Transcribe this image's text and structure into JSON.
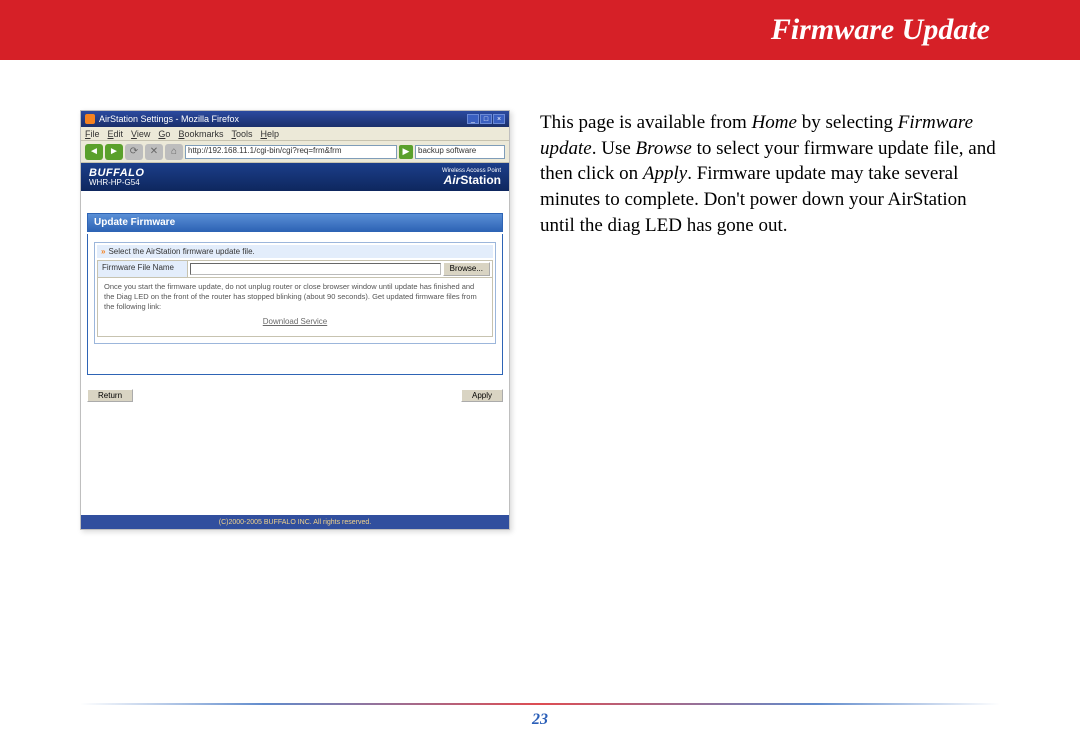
{
  "header": {
    "title": "Firmware Update"
  },
  "browser": {
    "window_title": "AirStation Settings - Mozilla Firefox",
    "menus": [
      "File",
      "Edit",
      "View",
      "Go",
      "Bookmarks",
      "Tools",
      "Help"
    ],
    "url": "http://192.168.11.1/cgi-bin/cgi?req=frm&frm",
    "search_placeholder": "backup software"
  },
  "router": {
    "brand": "BUFFALO",
    "model": "WHR-HP-G54",
    "tagline": "Wireless Access Point",
    "product": "AirStation",
    "section_title": "Update Firmware",
    "select_label": "Select the AirStation firmware update file.",
    "file_label": "Firmware File Name",
    "browse_label": "Browse...",
    "note": "Once you start the firmware update, do not unplug router or close browser window until update has finished and the Diag LED on the front of the router has stopped blinking (about 90 seconds). Get updated firmware files from the following link:",
    "download_link": "Download Service",
    "return_label": "Return",
    "apply_label": "Apply",
    "copyright": "(C)2000-2005 BUFFALO INC. All rights reserved."
  },
  "instructions": {
    "p1a": "This page is available from ",
    "home": "Home",
    "p1b": " by selecting ",
    "fw": "Firmware update",
    "p1c": ".  Use ",
    "browse": "Browse",
    "p1d": " to select your firmware update file, and then click on ",
    "apply": "Apply",
    "p1e": ". Firmware update may take several minutes to complete.  Don't power down your AirStation until the diag LED has gone out."
  },
  "page_number": "23"
}
